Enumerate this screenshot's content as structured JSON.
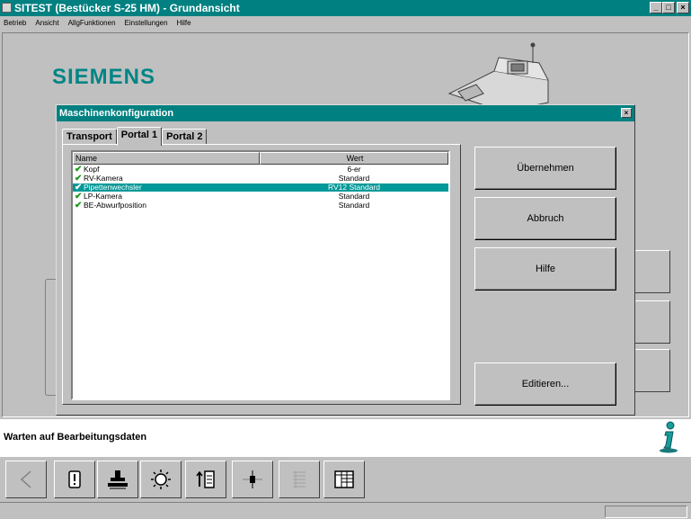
{
  "window": {
    "title": "SITEST (Bestücker S-25 HM) - Grundansicht",
    "minimize": "_",
    "maximize": "□",
    "close": "×"
  },
  "menu": [
    "Betrieb",
    "Ansicht",
    "AllgFunktionen",
    "Einstellungen",
    "Hilfe"
  ],
  "brand": "SIEMENS",
  "dialog": {
    "title": "Maschinenkonfiguration",
    "close": "×",
    "tabs": [
      {
        "label": "Transport",
        "active": false
      },
      {
        "label": "Portal 1",
        "active": true
      },
      {
        "label": "Portal 2",
        "active": false
      }
    ],
    "list": {
      "headers": {
        "name": "Name",
        "wert": "Wert"
      },
      "rows": [
        {
          "name": "Kopf",
          "wert": "6-er",
          "selected": false
        },
        {
          "name": "RV-Kamera",
          "wert": "Standard",
          "selected": false
        },
        {
          "name": "Pipettenwechsler",
          "wert": "RV12 Standard",
          "selected": true
        },
        {
          "name": "LP-Kamera",
          "wert": "Standard",
          "selected": false
        },
        {
          "name": "BE-Abwurfposition",
          "wert": "Standard",
          "selected": false
        }
      ]
    },
    "buttons": {
      "apply": "Übernehmen",
      "cancel": "Abbruch",
      "help": "Hilfe",
      "edit": "Editieren..."
    }
  },
  "status": {
    "text": "Warten auf Bearbeitungsdaten"
  },
  "toolbar": {
    "items": [
      {
        "name": "back-icon",
        "enabled": true
      },
      {
        "name": "warning-icon",
        "enabled": true
      },
      {
        "name": "stamp-icon",
        "enabled": true
      },
      {
        "name": "sun-icon",
        "enabled": true
      },
      {
        "name": "feeder-icon",
        "enabled": true
      },
      {
        "name": "slider-icon",
        "enabled": true
      },
      {
        "name": "list-icon",
        "enabled": false
      },
      {
        "name": "grid-icon",
        "enabled": true
      }
    ]
  },
  "colors": {
    "titlebar": "#008080",
    "brand": "#008585",
    "selection": "#009898",
    "check": "#1a9a1a"
  }
}
